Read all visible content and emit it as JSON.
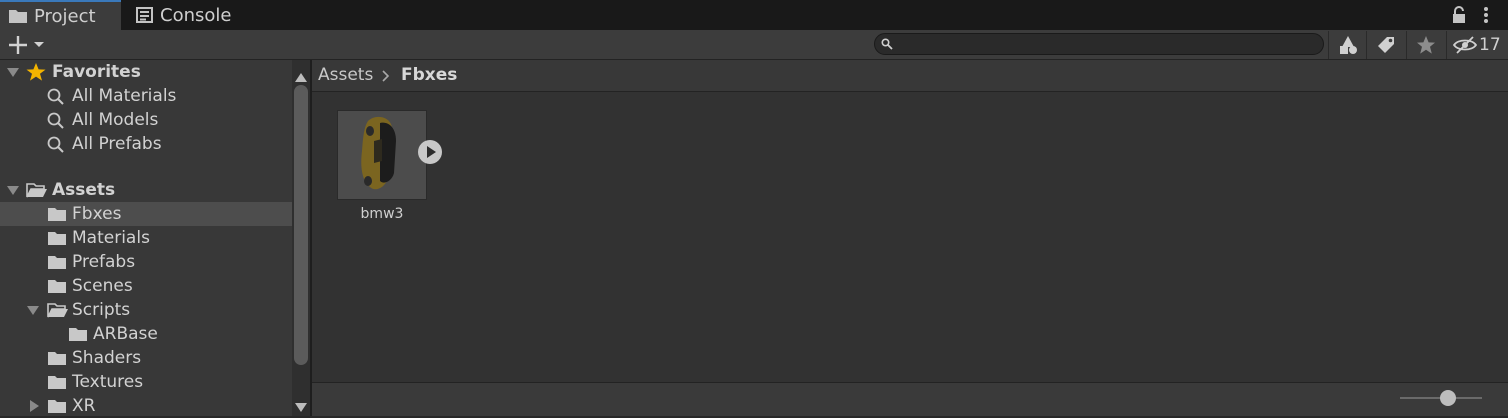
{
  "tabs": [
    {
      "label": "Project",
      "icon": "folder-icon",
      "active": true
    },
    {
      "label": "Console",
      "icon": "console-icon",
      "active": false
    }
  ],
  "toolbar": {
    "hidden_count": "17"
  },
  "tree": {
    "favorites": {
      "label": "Favorites",
      "items": [
        "All Materials",
        "All Models",
        "All Prefabs"
      ]
    },
    "assets": {
      "label": "Assets",
      "folders": [
        {
          "label": "Fbxes",
          "selected": true
        },
        {
          "label": "Materials"
        },
        {
          "label": "Prefabs"
        },
        {
          "label": "Scenes"
        },
        {
          "label": "Scripts",
          "expanded": true,
          "children": [
            "ARBase"
          ]
        },
        {
          "label": "Shaders"
        },
        {
          "label": "Textures"
        },
        {
          "label": "XR",
          "collapsed": true
        }
      ]
    }
  },
  "breadcrumb": {
    "root": "Assets",
    "current": "Fbxes"
  },
  "assets_grid": [
    {
      "name": "bmw3",
      "type": "model"
    }
  ],
  "zoom_slider": {
    "value": 0.58
  },
  "colors": {
    "accent": "#3a79bb",
    "selection": "#4d4d4d",
    "panel": "#383838"
  }
}
